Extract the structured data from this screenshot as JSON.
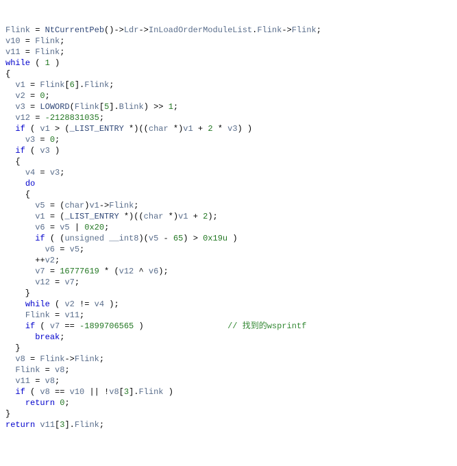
{
  "t": {
    "Flink": "Flink",
    "NtCurrentPeb": "NtCurrentPeb",
    "Ldr": "Ldr",
    "InLoadOrderModuleList": "InLoadOrderModuleList",
    "Blink": "Blink",
    "v1": "v1",
    "v2": "v2",
    "v3": "v3",
    "v4": "v4",
    "v5": "v5",
    "v6": "v6",
    "v7": "v7",
    "v8": "v8",
    "v10": "v10",
    "v11": "v11",
    "v12": "v12",
    "while": "while",
    "if": "if",
    "do": "do",
    "break": "break",
    "return": "return",
    "LOWORD": "LOWORD",
    "LIST_ENTRY": "_LIST_ENTRY",
    "char": "char",
    "unsigned___int8": "unsigned __int8",
    "n0": "0",
    "n1": "1",
    "n2": "2",
    "n3": "3",
    "n5": "5",
    "n6": "6",
    "n65": "65",
    "n0x19u": "0x19u",
    "n0x20": "0x20",
    "n_neg2128831035": "-2128831035",
    "n_16777619": "16777619",
    "n_neg1899706565": "-1899706565",
    "comment_wsprintf": "// 找到的wsprintf"
  }
}
